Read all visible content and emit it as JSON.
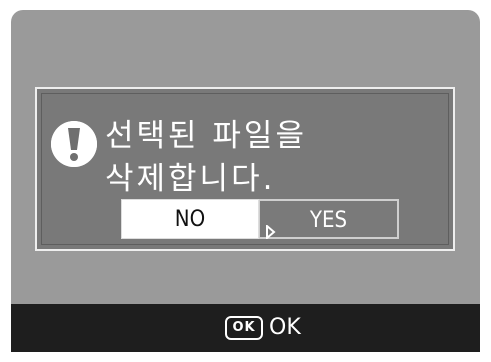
{
  "dialog": {
    "message": "선택된 파일을 삭제합니다.",
    "icon": "exclamation-icon",
    "buttons": {
      "no_label": "NO",
      "yes_label": "YES",
      "selected": "YES"
    }
  },
  "footer": {
    "ok_icon_text": "OK",
    "ok_label": "OK"
  },
  "colors": {
    "screen_background": "#9a9a9a",
    "dialog_background": "#797979",
    "footer_background": "#1e1e1e",
    "text": "#ffffff"
  }
}
